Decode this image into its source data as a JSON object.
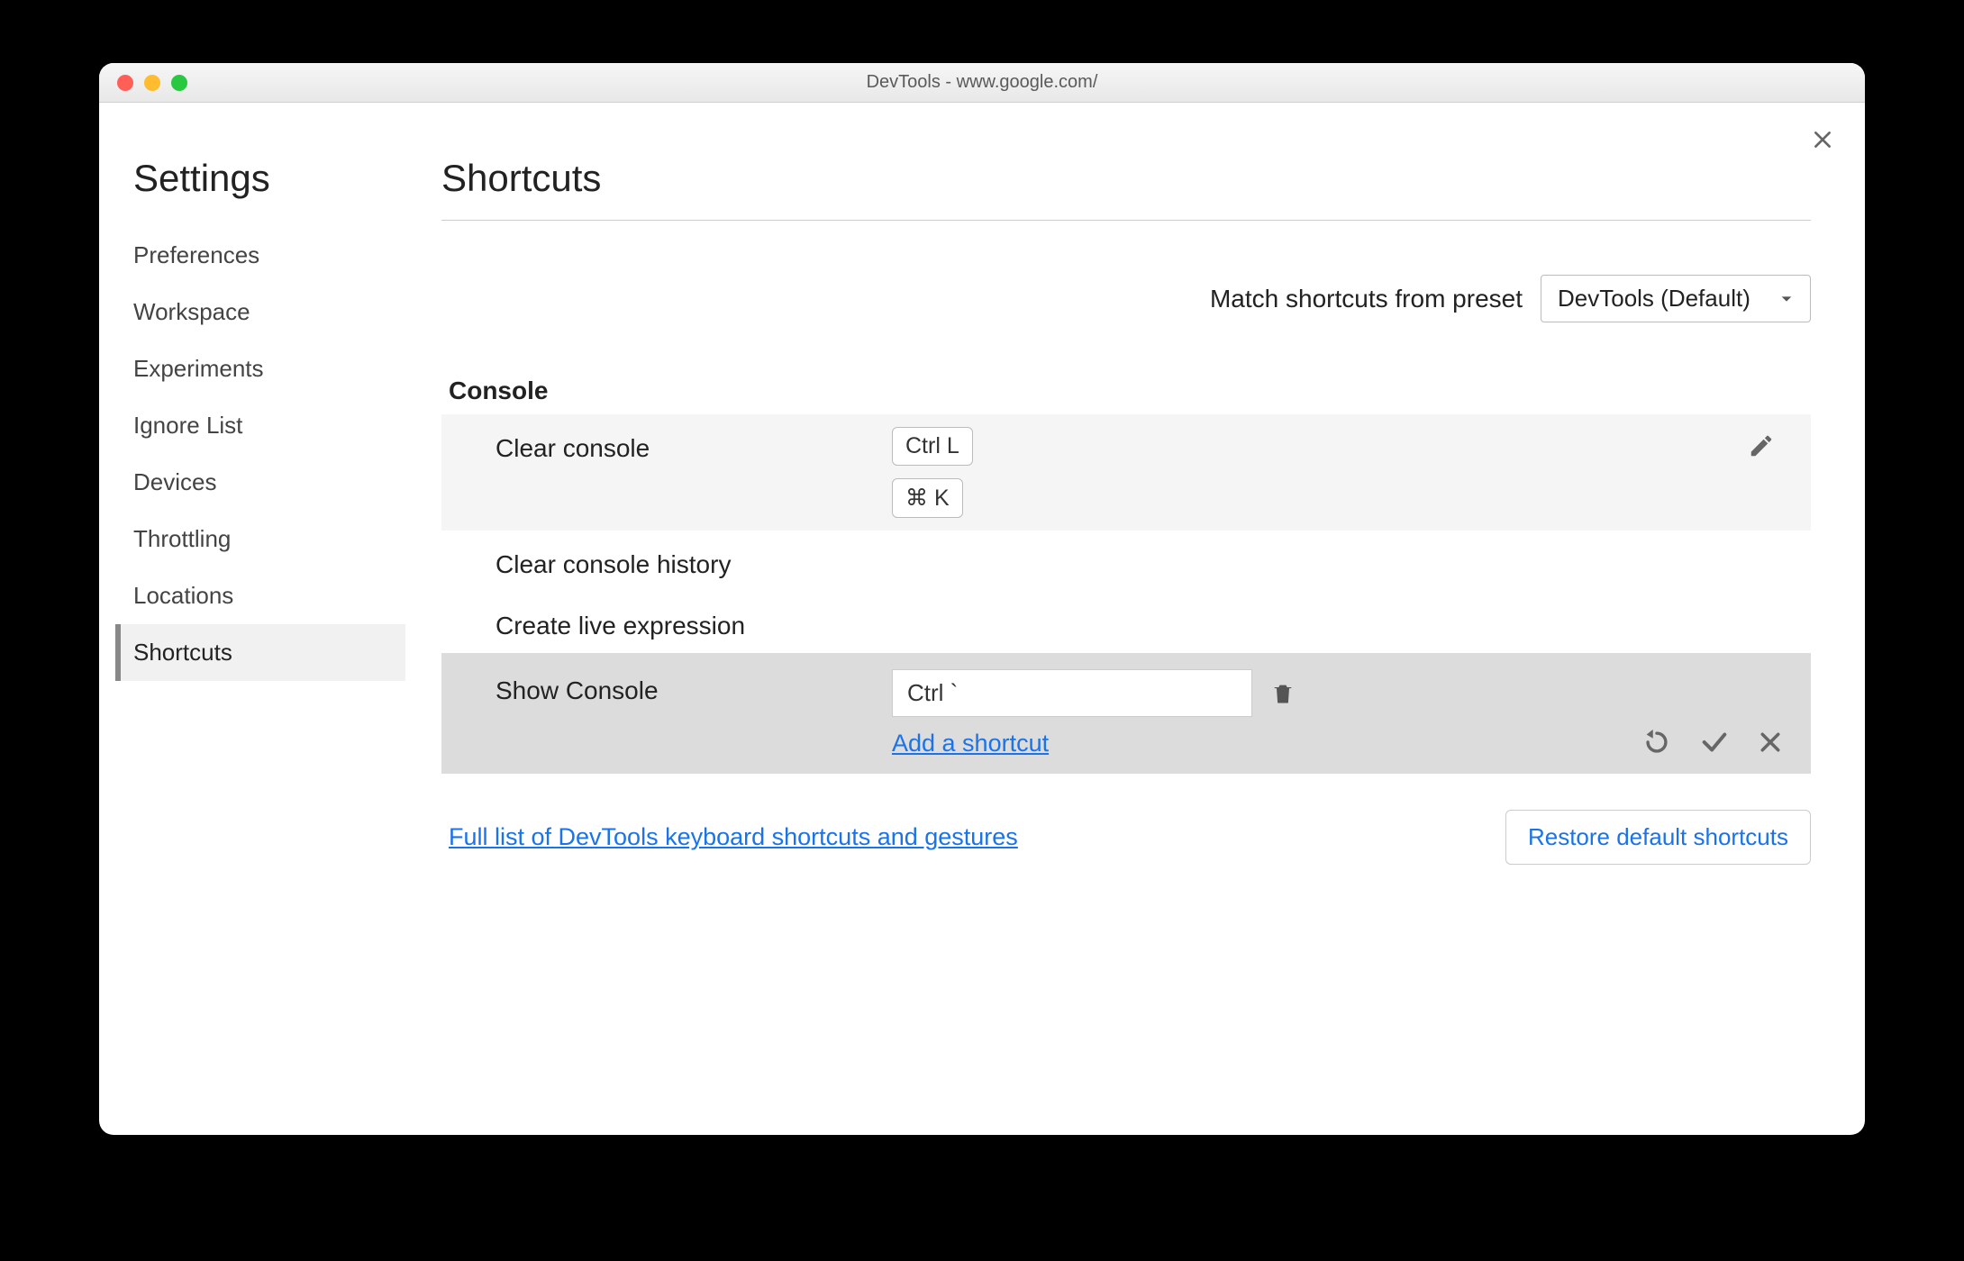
{
  "window": {
    "title": "DevTools - www.google.com/"
  },
  "sidebar": {
    "title": "Settings",
    "items": [
      {
        "label": "Preferences"
      },
      {
        "label": "Workspace"
      },
      {
        "label": "Experiments"
      },
      {
        "label": "Ignore List"
      },
      {
        "label": "Devices"
      },
      {
        "label": "Throttling"
      },
      {
        "label": "Locations"
      },
      {
        "label": "Shortcuts"
      }
    ],
    "active_index": 7
  },
  "main": {
    "title": "Shortcuts",
    "preset_label": "Match shortcuts from preset",
    "preset_value": "DevTools (Default)",
    "section_title": "Console",
    "rows": {
      "clear_console": {
        "label": "Clear console",
        "keys": [
          "Ctrl L",
          "⌘ K"
        ]
      },
      "clear_history": {
        "label": "Clear console history"
      },
      "create_live": {
        "label": "Create live expression"
      },
      "show_console": {
        "label": "Show Console",
        "input_value": "Ctrl `",
        "add_label": "Add a shortcut"
      }
    },
    "footer_link": "Full list of DevTools keyboard shortcuts and gestures",
    "restore_label": "Restore default shortcuts"
  }
}
